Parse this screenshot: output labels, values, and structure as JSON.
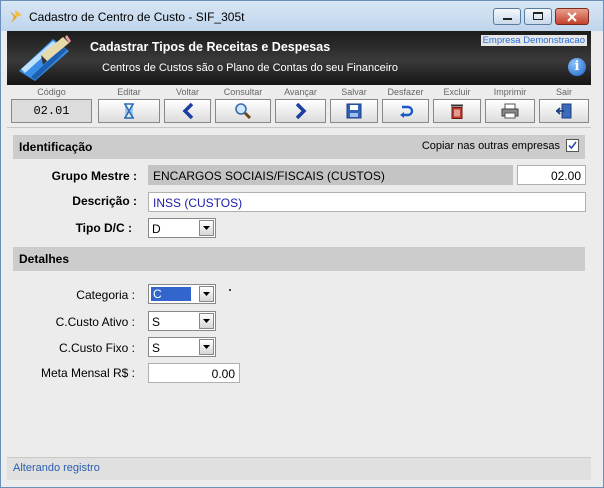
{
  "window": {
    "title": "Cadastro de Centro de Custo - SIF_305t"
  },
  "header": {
    "title": "Cadastrar Tipos de Receitas e Despesas",
    "subtitle": "Centros de Custos são o Plano de Contas do seu Financeiro",
    "company": "Empresa Demonstracao",
    "info_icon": "i"
  },
  "toolbar": {
    "code_label": "Código",
    "code_value": "02.01",
    "buttons": [
      {
        "label": "Editar",
        "icon": "hourglass-icon"
      },
      {
        "label": "Voltar",
        "icon": "arrow-left-icon"
      },
      {
        "label": "Consultar",
        "icon": "magnifier-icon"
      },
      {
        "label": "Avançar",
        "icon": "arrow-right-icon"
      },
      {
        "label": "Salvar",
        "icon": "floppy-icon"
      },
      {
        "label": "Desfazer",
        "icon": "undo-icon"
      },
      {
        "label": "Excluir",
        "icon": "trash-icon"
      },
      {
        "label": "Imprimir",
        "icon": "printer-icon"
      },
      {
        "label": "Sair",
        "icon": "exit-door-icon"
      }
    ]
  },
  "identificacao": {
    "title": "Identificação",
    "copy_label": "Copiar nas outras empresas",
    "copy_checked": true,
    "grupo_label": "Grupo Mestre :",
    "grupo_value": "ENCARGOS SOCIAIS/FISCAIS (CUSTOS)",
    "grupo_code": "02.00",
    "descricao_label": "Descrição :",
    "descricao_value": "INSS (CUSTOS)",
    "tipo_label": "Tipo  D/C :",
    "tipo_value": "D"
  },
  "detalhes": {
    "title": "Detalhes",
    "categoria_label": "Categoria :",
    "categoria_value": "C",
    "ccusto_ativo_label": "C.Custo Ativo :",
    "ccusto_ativo_value": "S",
    "ccusto_fixo_label": "C.Custo Fixo :",
    "ccusto_fixo_value": "S",
    "meta_label": "Meta Mensal R$ :",
    "meta_value": "0.00"
  },
  "status": {
    "text": "Alterando registro"
  }
}
